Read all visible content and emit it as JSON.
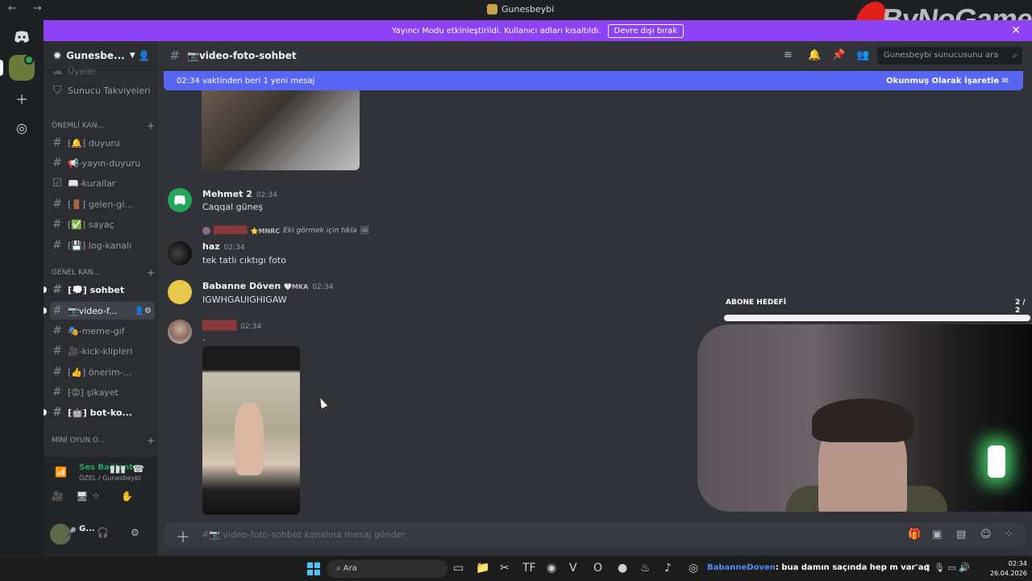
{
  "window": {
    "title": "Gunesbeybi",
    "nav": "← →",
    "watermark": "ByNoGame"
  },
  "banner": {
    "text": "Yayıncı Modu etkinleştirildi. Kullanıcı adları kısaltıldı.",
    "button": "Devre dışı bırak",
    "close": "✕"
  },
  "server": {
    "name": "Gunesbe...",
    "items": [
      {
        "label": "Üyeler"
      },
      {
        "label": "Sunucu Takviyeleri"
      }
    ],
    "categories": [
      "ÖNEMLİ KAN...",
      "GENEL KAN...",
      "MİNİ OYUN O..."
    ],
    "channels": [
      {
        "label": "⁅🔔⁆ duyuru"
      },
      {
        "label": "📢-yayın-duyuru"
      },
      {
        "label": "📖-kurallar"
      },
      {
        "label": "⁅🚪⁆ gelen-gi..."
      },
      {
        "label": "⁅✅⁆ sayaç"
      },
      {
        "label": "⁅💾⁆ log-kanalı"
      },
      {
        "label": "⁅💭⁆ sohbet"
      },
      {
        "label": "📷video-f..."
      },
      {
        "label": "🎭-meme-gif"
      },
      {
        "label": "🎥-kick-klipleri"
      },
      {
        "label": "⁅👍⁆ önerim-..."
      },
      {
        "label": "⁅😡⁆ şikayet"
      },
      {
        "label": "⁅🤖⁆ bot-ko..."
      }
    ]
  },
  "voice": {
    "status": "Ses Bağlantısı K",
    "sub": "ÖZEL / Gunesbeybi"
  },
  "user": {
    "name": "G..."
  },
  "channel": {
    "name": "📷video-foto-sohbet",
    "search_placeholder": "Gunesbeybi sunucusunu ara",
    "new_messages": "02:34 vaktinden beri 1 yeni mesaj",
    "mark_read": "Okunmuş Olarak İşaretle",
    "composer_placeholder": "#📷 video-foto-sohbet kanalına mesaj gönder"
  },
  "messages": [
    {
      "author": "Mehmet 2",
      "time": "02:34",
      "text": "Caqqal güneş"
    },
    {
      "reply_tag": "⭐MNRC",
      "reply_text": "Eki görmek için tıkla",
      "author": "haz",
      "time": "02:34",
      "text": "tek tatlı cıktıgı foto"
    },
    {
      "author": "Babanne Döven",
      "tag": "🤍MKA",
      "time": "02:34",
      "text": "IGWHGAUIGHIGAW"
    },
    {
      "time": "02:34",
      "text": "."
    }
  ],
  "overlay": {
    "label": "ABONE HEDEFİ",
    "count": "2 / 2",
    "progress": 1.0
  },
  "taskbar": {
    "search": "Ara",
    "chat_name": "BabanneDoven",
    "chat_text": ": bua damın saçında hep m var aq",
    "time": "02:34",
    "date": "26.04.2026"
  }
}
